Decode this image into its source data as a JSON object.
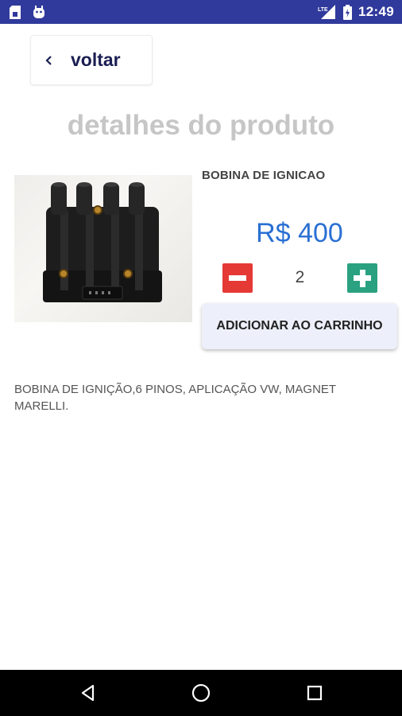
{
  "status_bar": {
    "time": "12:49",
    "network": "LTE",
    "left_icons": [
      "sim-card-icon",
      "android-debug-icon"
    ],
    "right_icons": [
      "signal-icon",
      "battery-icon"
    ]
  },
  "header": {
    "back_label": "voltar"
  },
  "page": {
    "title": "detalhes do produto"
  },
  "product": {
    "name": "BOBINA DE IGNICAO",
    "price": "R$ 400",
    "quantity": "2",
    "add_to_cart_label": "ADICIONAR AO CARRINHO",
    "description": "BOBINA DE IGNIÇÃO,6 PINOS, APLICAÇÃO VW, MAGNET MARELLI."
  },
  "nav_bar": {
    "buttons": [
      "back-triangle-icon",
      "home-circle-icon",
      "recents-square-icon"
    ]
  },
  "colors": {
    "status_bar": "#303a9c",
    "price": "#2a6fd3",
    "minus_button": "#e53935",
    "plus_button": "#2aa180",
    "title": "#c6c6c6"
  }
}
